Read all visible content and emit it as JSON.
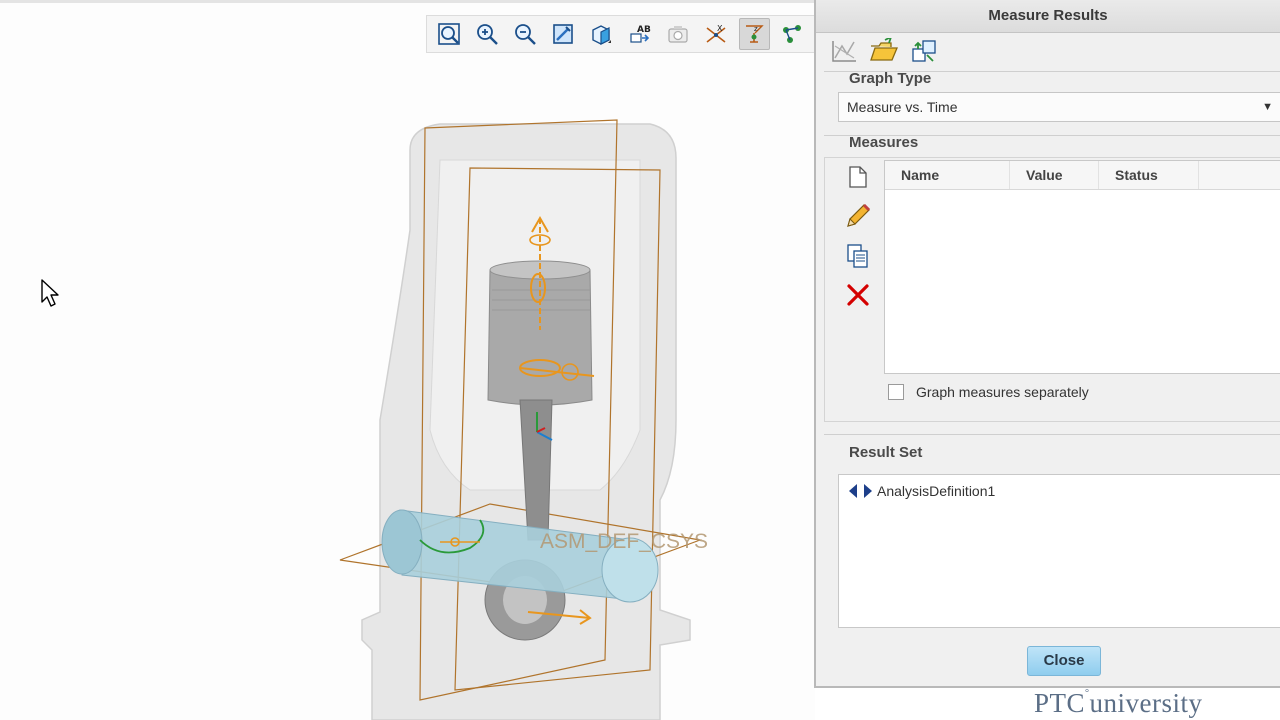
{
  "viewport": {
    "toolbar_icons": [
      "zoom-fit-icon",
      "zoom-in-icon",
      "zoom-out-icon",
      "repaint-icon",
      "view-orientation-icon",
      "annotation-display-icon",
      "saved-views-icon",
      "datum-display-icon",
      "spin-center-icon",
      "csys-display-icon"
    ],
    "model_label": "ASM_DEF_CSYS"
  },
  "dialog": {
    "title": "Measure Results",
    "graph_type": {
      "label": "Graph Type",
      "selected": "Measure vs. Time"
    },
    "measures": {
      "label": "Measures",
      "columns": [
        "Name",
        "Value",
        "Status"
      ],
      "checkbox_label": "Graph measures separately"
    },
    "result_set": {
      "label": "Result Set",
      "items": [
        "AnalysisDefinition1"
      ]
    },
    "close_label": "Close"
  },
  "brand": {
    "ptc": "PTC",
    "university": "university"
  },
  "colors": {
    "accent_orange": "#e8961e",
    "delete_red": "#d40000",
    "close_button": "#a9daf3"
  }
}
